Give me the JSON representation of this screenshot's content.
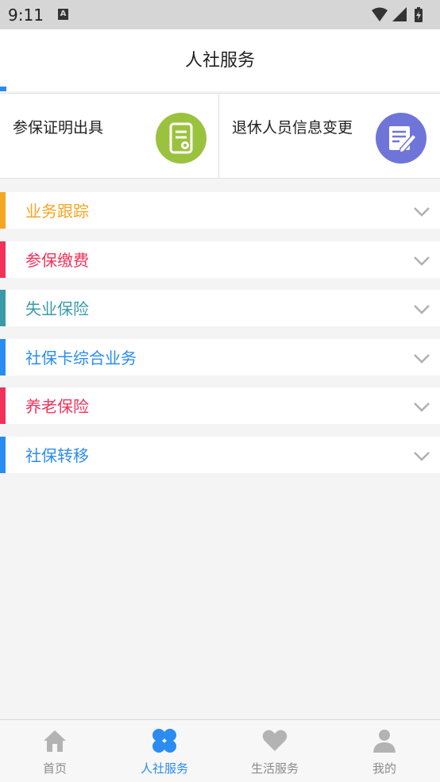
{
  "status_bar": {
    "time": "9:11",
    "notification_badge": "A"
  },
  "header": {
    "title": "人社服务"
  },
  "cards": [
    {
      "label": "参保证明出具",
      "icon": "certificate-icon",
      "color": "#9bc23f"
    },
    {
      "label": "退休人员信息变更",
      "icon": "edit-document-icon",
      "color": "#6f75d8"
    }
  ],
  "list": [
    {
      "label": "业务跟踪",
      "color": "#f5a623"
    },
    {
      "label": "参保缴费",
      "color": "#f0325a"
    },
    {
      "label": "失业保险",
      "color": "#3a9aa8"
    },
    {
      "label": "社保卡综合业务",
      "color": "#2a8cf0"
    },
    {
      "label": "养老保险",
      "color": "#f0325a"
    },
    {
      "label": "社保转移",
      "color": "#2a8cf0"
    }
  ],
  "bottom_nav": [
    {
      "label": "首页",
      "icon": "home-icon"
    },
    {
      "label": "人社服务",
      "icon": "clover-icon",
      "active": true
    },
    {
      "label": "生活服务",
      "icon": "heart-icon"
    },
    {
      "label": "我的",
      "icon": "user-icon"
    }
  ]
}
